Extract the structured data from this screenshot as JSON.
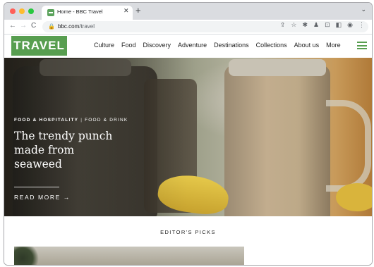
{
  "browser": {
    "tab": {
      "title": "Home - BBC Travel",
      "close": "✕"
    },
    "new_tab": "+",
    "tab_menu": "⌄",
    "nav": {
      "back": "←",
      "forward": "→",
      "reload": "C"
    },
    "url": {
      "domain": "bbc.com",
      "path": "/travel"
    },
    "toolbar_icons": [
      "share-icon",
      "star-icon",
      "extensions-icon",
      "lab-icon",
      "cast-icon",
      "sidepanel-icon",
      "profile-icon",
      "more-icon"
    ],
    "toolbar_glyphs": [
      "⇪",
      "☆",
      "✱",
      "♟",
      "⊡",
      "◧",
      "◉",
      "⋮"
    ]
  },
  "site": {
    "logo": "TRAVEL",
    "brand_color": "#589e50",
    "nav": [
      "Culture",
      "Food",
      "Discovery",
      "Adventure",
      "Destinations",
      "Collections",
      "About us"
    ],
    "more": "More"
  },
  "hero": {
    "kicker_primary": "FOOD & HOSPITALITY",
    "kicker_sep": "|",
    "kicker_secondary": "FOOD & DRINK",
    "headline": "The trendy punch made from seaweed",
    "read_more": "READ MORE",
    "read_more_arrow": "→"
  },
  "picks": {
    "title": "EDITOR'S PICKS"
  }
}
